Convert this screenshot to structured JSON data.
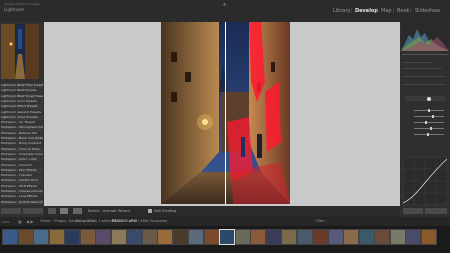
{
  "app": {
    "name_line1": "Adobe Lightroom Classic",
    "name_line2": "Lightroom",
    "modules": [
      "Library",
      "Develop",
      "Map",
      "Book",
      "Slideshow"
    ],
    "active_module": "Develop"
  },
  "presets": [
    "Lightroom B&W Filter Presets",
    "Lightroom B&W Presets",
    "Lightroom B&W Toned Presets",
    "Lightroom Color Presets",
    "Lightroom Effect Presets",
    "Lightroom General Presets",
    "Lightroom Video Presets",
    "Photoplus – Air Thread",
    "Photoplus – Atmosphere Presets",
    "Photoplus – Balance Mix",
    "Photoplus – Black and White",
    "Photoplus – Bring Contrast",
    "Photoplus – Color to Haze",
    "Photoplus – Cinematic Colors",
    "Photoplus – Color + Mix",
    "Photoplus – Cross Fx",
    "Photoplus – Film Effects",
    "Photoplus – Fujinator",
    "Photoplus – Golden Hour",
    "Photoplus – HDR Effects",
    "Photoplus – Intense Colours",
    "Photoplus – Lens Effects",
    "Photoplus – Portrait Retouch"
  ],
  "toolbar": {
    "before_after": "Before : Animatt Wizard",
    "soft_proofing": "Soft Proofing"
  },
  "filmstrip": {
    "path": "Folder : Prague, Germany, 2019",
    "count": "182 photos / 1 selected /",
    "filename": "P2B0003.ARW",
    "extra": "/ ARW Panorama",
    "filter": "Filter :"
  },
  "colors": {
    "accent": "#e8e8e8",
    "panel": "#313131",
    "canvas": "#c9c9c9"
  }
}
